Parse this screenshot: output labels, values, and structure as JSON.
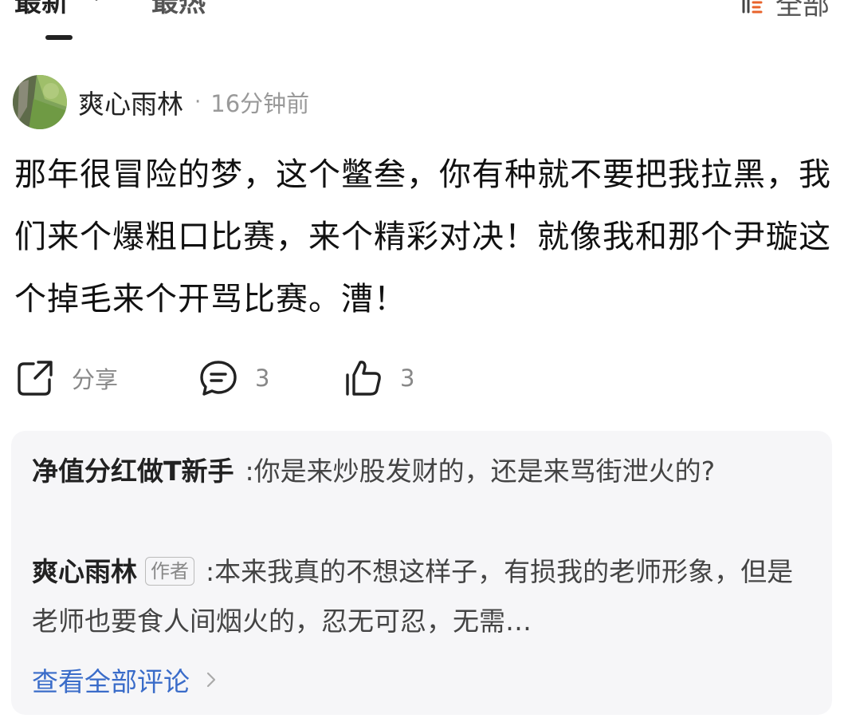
{
  "tabs": {
    "newest": "最新",
    "hot": "最热",
    "filter_label": "全部"
  },
  "post": {
    "author": "爽心雨林",
    "separator": "·",
    "time": "16分钟前",
    "body": "那年很冒险的梦，这个鳖叁，你有种就不要把我拉黑，我们来个爆粗口比赛，来个精彩对决！就像我和那个尹璇这个掉毛来个开骂比赛。漕！",
    "actions": {
      "share_label": "分享",
      "comment_count": "3",
      "like_count": "3"
    }
  },
  "comments": [
    {
      "author": "净值分红做T新手",
      "separator": ":",
      "text": "你是来炒股发财的，还是来骂街泄火的?"
    },
    {
      "author": "爽心雨林",
      "tag": "作者",
      "separator": ":",
      "text": "本来我真的不想这样子，有损我的老师形象，但是老师也要食人间烟火的，忍无可忍，无需…"
    }
  ],
  "view_all_label": "查看全部评论",
  "colors": {
    "link": "#3a6cc9",
    "muted": "#999999",
    "comment_bg": "#f6f6f8"
  },
  "icons": [
    "chevron-down-icon",
    "filter-icon",
    "share-icon",
    "comment-icon",
    "like-icon",
    "chevron-right-icon"
  ]
}
